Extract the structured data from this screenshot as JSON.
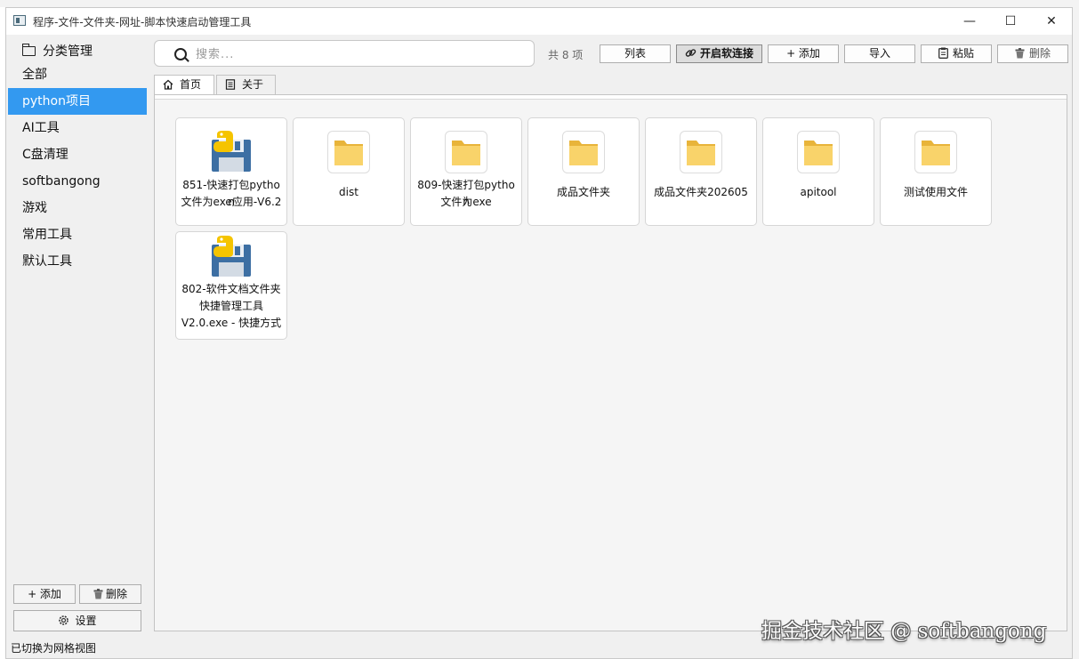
{
  "window": {
    "title": "程序-文件-文件夹-网址-脚本快速启动管理工具",
    "minimize_glyph": "—",
    "maximize_glyph": "☐",
    "close_glyph": "✕"
  },
  "sidebar": {
    "header": "分类管理",
    "items": [
      {
        "label": "全部"
      },
      {
        "label": "python项目"
      },
      {
        "label": "AI工具"
      },
      {
        "label": "C盘清理"
      },
      {
        "label": "softbangong"
      },
      {
        "label": "游戏"
      },
      {
        "label": "常用工具"
      },
      {
        "label": "默认工具"
      }
    ],
    "selected_index": 1,
    "add_label": "+ 添加",
    "delete_label": "删除",
    "settings_label": "设置"
  },
  "toolbar": {
    "search_placeholder": "搜索...",
    "count_text": "共 8 项",
    "list_label": "列表",
    "softlink_label": "开启软连接",
    "add_label": "+ 添加",
    "import_label": "导入",
    "paste_label": "粘贴",
    "delete_label": "删除"
  },
  "tabs": [
    {
      "label": "首页",
      "icon": "home-icon",
      "active": true
    },
    {
      "label": "关于",
      "icon": "document-icon",
      "active": false
    }
  ],
  "items": [
    {
      "label_lines": [
        "851-快速打包python",
        "文件为exe应用-V6.2"
      ],
      "icon": "python-installer-icon"
    },
    {
      "label_lines": [
        "dist"
      ],
      "icon": "folder-icon"
    },
    {
      "label_lines": [
        "809-快速打包python",
        "文件为exe"
      ],
      "icon": "folder-icon"
    },
    {
      "label_lines": [
        "成品文件夹"
      ],
      "icon": "folder-icon"
    },
    {
      "label_lines": [
        "成品文件夹202605"
      ],
      "icon": "folder-icon"
    },
    {
      "label_lines": [
        "apitool"
      ],
      "icon": "folder-icon"
    },
    {
      "label_lines": [
        "测试使用文件"
      ],
      "icon": "folder-icon"
    },
    {
      "label_lines": [
        "802-软件文档文件夹",
        "快捷管理工具",
        "V2.0.exe - 快捷方式"
      ],
      "icon": "python-installer-icon"
    }
  ],
  "status": {
    "text": "已切换为网格视图"
  },
  "watermark": "掘金技术社区 @ softbangong",
  "colors": {
    "selected": "#3399f0",
    "folder": "#f7c948",
    "window_bg": "#f0f0f0"
  }
}
